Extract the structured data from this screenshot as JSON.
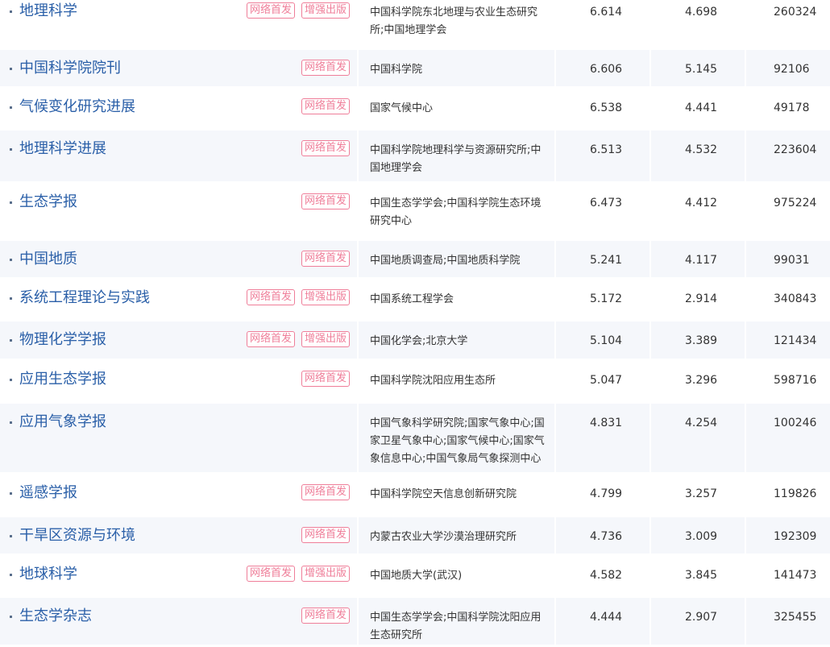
{
  "journals": [
    {
      "name": "地理科学",
      "badges": [
        "网络首发",
        "增强出版"
      ],
      "org": "中国科学院东北地理与农业生态研究所;中国地理学会",
      "if1": "6.614",
      "if2": "4.698",
      "count": "260324"
    },
    {
      "name": "中国科学院院刊",
      "badges": [
        "网络首发"
      ],
      "org": "中国科学院",
      "if1": "6.606",
      "if2": "5.145",
      "count": "92106"
    },
    {
      "name": "气候变化研究进展",
      "badges": [
        "网络首发"
      ],
      "org": "国家气候中心",
      "if1": "6.538",
      "if2": "4.441",
      "count": "49178"
    },
    {
      "name": "地理科学进展",
      "badges": [
        "网络首发"
      ],
      "org": "中国科学院地理科学与资源研究所;中国地理学会",
      "if1": "6.513",
      "if2": "4.532",
      "count": "223604"
    },
    {
      "name": "生态学报",
      "badges": [
        "网络首发"
      ],
      "org": "中国生态学学会;中国科学院生态环境研究中心",
      "if1": "6.473",
      "if2": "4.412",
      "count": "975224"
    },
    {
      "name": "中国地质",
      "badges": [
        "网络首发"
      ],
      "org": "中国地质调查局;中国地质科学院",
      "if1": "5.241",
      "if2": "4.117",
      "count": "99031"
    },
    {
      "name": "系统工程理论与实践",
      "badges": [
        "网络首发",
        "增强出版"
      ],
      "org": "中国系统工程学会",
      "if1": "5.172",
      "if2": "2.914",
      "count": "340843"
    },
    {
      "name": "物理化学学报",
      "badges": [
        "网络首发",
        "增强出版"
      ],
      "org": "中国化学会;北京大学",
      "if1": "5.104",
      "if2": "3.389",
      "count": "121434"
    },
    {
      "name": "应用生态学报",
      "badges": [
        "网络首发"
      ],
      "org": "中国科学院沈阳应用生态所",
      "if1": "5.047",
      "if2": "3.296",
      "count": "598716"
    },
    {
      "name": "应用气象学报",
      "badges": [],
      "org": "中国气象科学研究院;国家气象中心;国家卫星气象中心;国家气候中心;国家气象信息中心;中国气象局气象探测中心",
      "if1": "4.831",
      "if2": "4.254",
      "count": "100246"
    },
    {
      "name": "遥感学报",
      "badges": [
        "网络首发"
      ],
      "org": "中国科学院空天信息创新研究院",
      "if1": "4.799",
      "if2": "3.257",
      "count": "119826"
    },
    {
      "name": "干旱区资源与环境",
      "badges": [
        "网络首发"
      ],
      "org": "内蒙古农业大学沙漠治理研究所",
      "if1": "4.736",
      "if2": "3.009",
      "count": "192309"
    },
    {
      "name": "地球科学",
      "badges": [
        "网络首发",
        "增强出版"
      ],
      "org": "中国地质大学(武汉)",
      "if1": "4.582",
      "if2": "3.845",
      "count": "141473"
    },
    {
      "name": "生态学杂志",
      "badges": [
        "网络首发"
      ],
      "org": "中国生态学学会;中国科学院沈阳应用生态研究所",
      "if1": "4.444",
      "if2": "2.907",
      "count": "325455"
    }
  ]
}
